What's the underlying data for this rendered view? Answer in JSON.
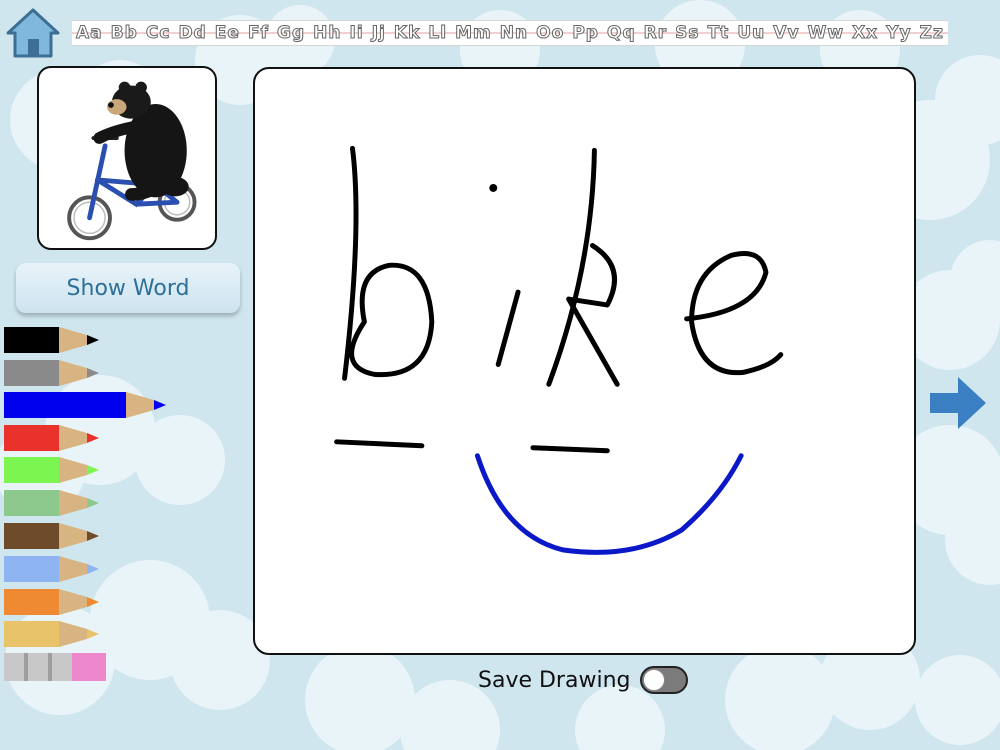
{
  "alphabet": [
    "Aa",
    "Bb",
    "Cc",
    "Dd",
    "Ee",
    "Ff",
    "Gg",
    "Hh",
    "Ii",
    "Jj",
    "Kk",
    "Ll",
    "Mm",
    "Nn",
    "Oo",
    "Pp",
    "Qq",
    "Rr",
    "Ss",
    "Tt",
    "Uu",
    "Vv",
    "Ww",
    "Xx",
    "Yy",
    "Zz"
  ],
  "show_word_label": "Show Word",
  "save_label": "Save Drawing",
  "save_enabled": false,
  "pencil_colors": [
    "#000000",
    "#8a8a8a",
    "#0000ee",
    "#e8322b",
    "#7cf550",
    "#8dc98d",
    "#6e4c2b",
    "#8fb4f2",
    "#f08a32",
    "#e9c36a"
  ],
  "selected_pencil_index": 2,
  "eraser_colors": [
    "#c8c8c8",
    "#ee88cc"
  ],
  "icons": {
    "home": "home-icon",
    "next": "arrow-right-icon"
  },
  "canvas_content": "bike"
}
